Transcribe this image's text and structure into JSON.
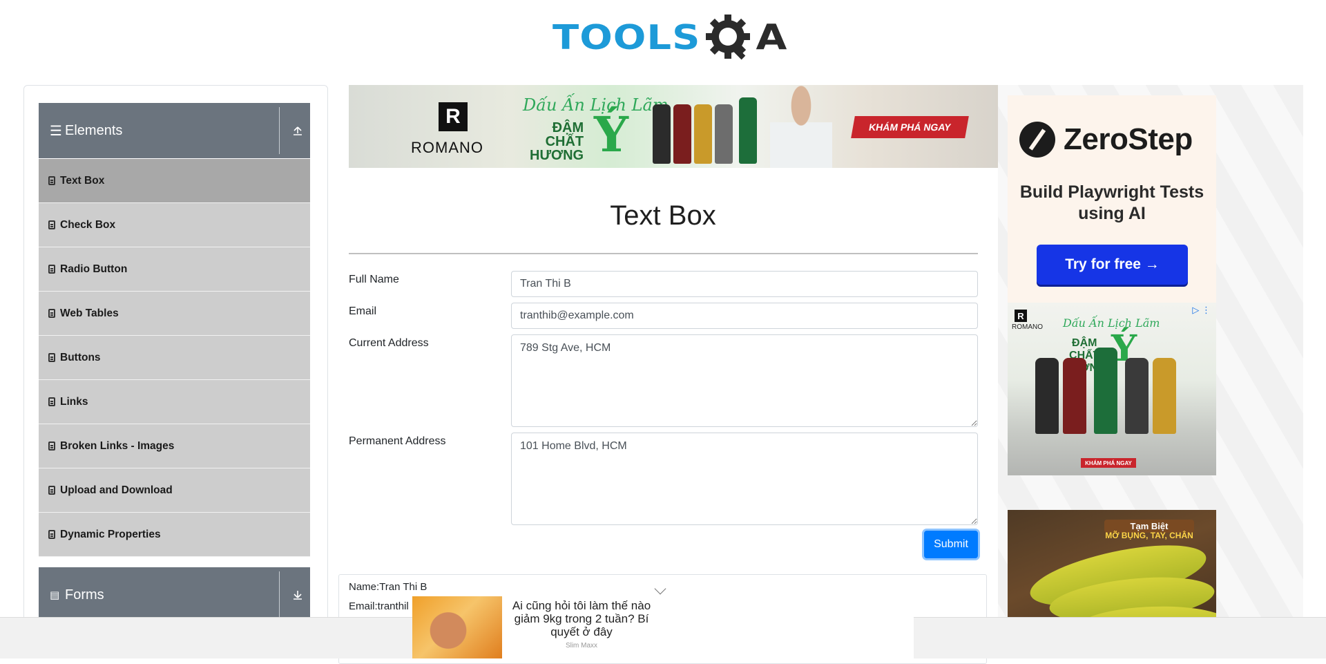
{
  "header": {
    "logo_tools": "TOOLS",
    "logo_qa": "A"
  },
  "sidebar": {
    "group_elements": {
      "label": "Elements",
      "icon": "menu-icon",
      "toggle_icon": "collapse-up-icon"
    },
    "items": [
      {
        "label": "Text Box",
        "active": true
      },
      {
        "label": "Check Box"
      },
      {
        "label": "Radio Button"
      },
      {
        "label": "Web Tables"
      },
      {
        "label": "Buttons"
      },
      {
        "label": "Links"
      },
      {
        "label": "Broken Links - Images"
      },
      {
        "label": "Upload and Download"
      },
      {
        "label": "Dynamic Properties"
      }
    ],
    "group_forms": {
      "label": "Forms",
      "icon": "document-icon",
      "toggle_icon": "expand-down-icon"
    }
  },
  "top_banner": {
    "brand": "ROMANO",
    "brand_mark": "R",
    "tagline": "Dấu Ấn Lịch Lãm",
    "headline": "ĐẬM\nCHẤT\nHƯƠNG",
    "headline_letter": "Ý",
    "cta": "KHÁM PHÁ NGAY"
  },
  "main": {
    "title": "Text Box",
    "full_name_label": "Full Name",
    "full_name_value": "Tran Thi B",
    "email_label": "Email",
    "email_value": "tranthib@example.com",
    "current_address_label": "Current Address",
    "current_address_value": "789 Stg Ave, HCM",
    "permanent_address_label": "Permanent Address",
    "permanent_address_value": "101 Home Blvd, HCM",
    "submit_label": "Submit",
    "output_name": "Name:Tran Thi B",
    "output_email": "Email:tranthil"
  },
  "right_ads": {
    "zerostep_name": "ZeroStep",
    "zerostep_sub": "Build Playwright Tests using AI",
    "zerostep_cta": "Try for free →",
    "romano_brand": "ROMANO",
    "romano_mark": "R",
    "romano_tagline": "Dấu Ấn Lịch Lãm",
    "romano_headline": "ĐẬM\nCHẤT\nHƯƠNG",
    "romano_letter": "Ý",
    "romano_cta": "KHÁM PHÁ NGAY",
    "banana_title": "Tạm Biệt",
    "banana_sub": "MỠ BỤNG, TAY, CHÂN"
  },
  "bottom_ad": {
    "text": "Ai cũng hỏi tôi làm thế nào giảm 9kg trong 2 tuần? Bí quyết ở đây",
    "source": "Slim Maxx"
  },
  "colors": {
    "accent": "#007bff",
    "logo_blue": "#1d9ad8",
    "sidebar_header": "#6b747e",
    "sidebar_item": "#cdcdcd",
    "sidebar_active": "#a8a8a8"
  }
}
